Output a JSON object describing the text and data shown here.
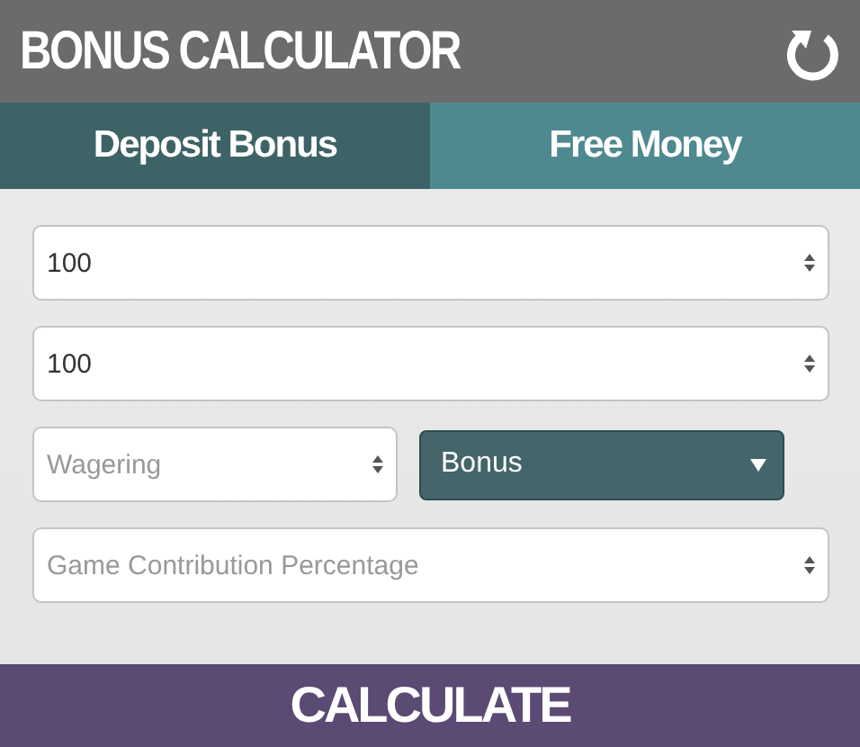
{
  "header": {
    "title": "BONUS CALCULATOR"
  },
  "tabs": [
    {
      "label": "Deposit Bonus",
      "selected": true
    },
    {
      "label": "Free Money",
      "selected": false
    }
  ],
  "form_rows": [
    {
      "fields": [
        {
          "kind": "number",
          "value": "100"
        }
      ]
    },
    {
      "fields": [
        {
          "kind": "number",
          "value": "100"
        }
      ]
    },
    {
      "fields": [
        {
          "kind": "number",
          "placeholder": "Wagering"
        },
        {
          "kind": "select",
          "value": "Bonus"
        }
      ]
    },
    {
      "fields": [
        {
          "kind": "number",
          "placeholder": "Game Contribution Percentage"
        }
      ]
    }
  ],
  "calculate_button": {
    "label": "CALCULATE"
  }
}
